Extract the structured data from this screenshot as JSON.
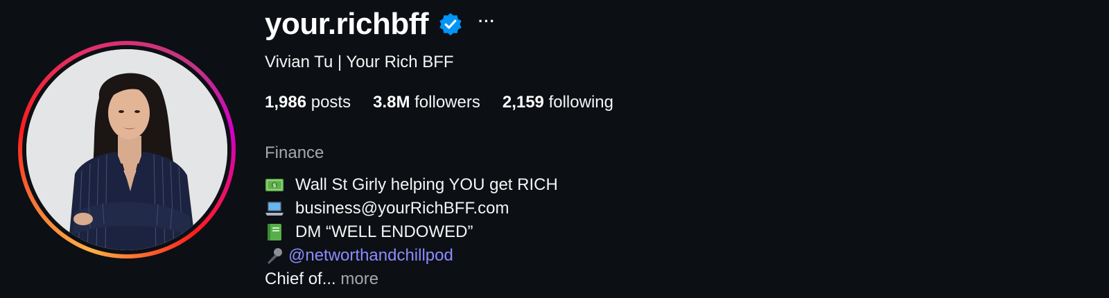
{
  "profile": {
    "username": "your.richbff",
    "verified": true,
    "more_label": "···",
    "full_name": "Vivian Tu | Your Rich BFF",
    "stats": {
      "posts_count": "1,986",
      "posts_label": "posts",
      "followers_count": "3.8M",
      "followers_label": "followers",
      "following_count": "2,159",
      "following_label": "following"
    },
    "category": "Finance",
    "bio": {
      "line1_icon": "money-bill-icon",
      "line1": "Wall St Girly helping YOU get RICH",
      "line2_icon": "laptop-icon",
      "line2": "business@yourRichBFF.com",
      "line3_icon": "green-book-icon",
      "line3": "DM “WELL ENDOWED”",
      "line4_icon": "microphone-icon",
      "line4_mention": "@networthandchillpod",
      "line5": "Chief of...",
      "more_link": "more"
    }
  },
  "colors": {
    "background": "#0c0f14",
    "verified_blue": "#0095f6",
    "mention": "#8c8cff",
    "muted": "#a8a8a8"
  }
}
